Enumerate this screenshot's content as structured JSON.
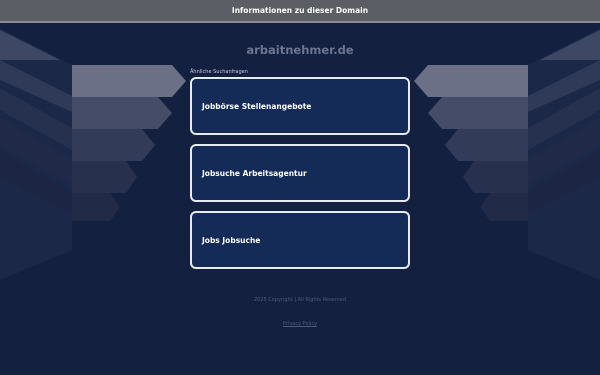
{
  "topbar": {
    "label": "Informationen zu dieser Domain"
  },
  "domain": "arbaitnehmer.de",
  "related_label": "Ähnliche Suchanfragen",
  "cards": [
    {
      "label": "Jobbörse Stellenangebote"
    },
    {
      "label": "Jobsuche Arbeitsagentur"
    },
    {
      "label": "Jobs Jobsuche"
    }
  ],
  "footer": {
    "copyright": "2025 Copyright | All Rights Reserved",
    "privacy": "Privacy Policy"
  },
  "colors": {
    "background": "#142040",
    "card_fill": "#142a57",
    "card_border": "#e6eaf2",
    "topbar": "#5b5e65"
  }
}
